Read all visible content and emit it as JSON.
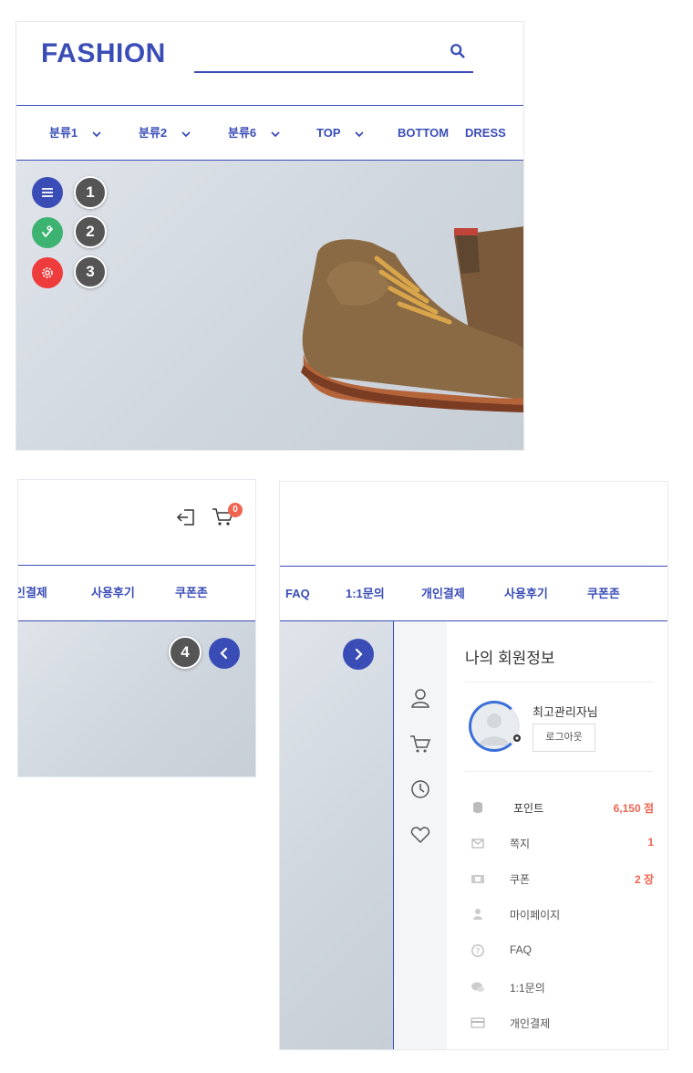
{
  "header": {
    "logo": "FASHION",
    "search_placeholder": ""
  },
  "nav_panel1": [
    {
      "label": "분류1",
      "has_dropdown": true
    },
    {
      "label": "분류2",
      "has_dropdown": true
    },
    {
      "label": "분류6",
      "has_dropdown": true
    },
    {
      "label": "TOP",
      "has_dropdown": true
    },
    {
      "label": "BOTTOM",
      "has_dropdown": false
    },
    {
      "label": "DRESS",
      "has_dropdown": false
    }
  ],
  "quick_buttons": [
    {
      "icon": "menu-icon",
      "badge": "1",
      "color": "#3a4db7"
    },
    {
      "icon": "thumb-icon",
      "badge": "2",
      "color": "#3cb371"
    },
    {
      "icon": "gear-icon",
      "badge": "3",
      "color": "#ee3b3b"
    }
  ],
  "panel2": {
    "cart_count": "0",
    "nav": [
      "인결제",
      "사용후기",
      "쿠폰존"
    ],
    "badge": "4"
  },
  "panel3": {
    "nav": [
      "FAQ",
      "1:1문의",
      "개인결제",
      "사용후기",
      "쿠폰존"
    ],
    "member_title": "나의 회원정보",
    "user_name": "최고관리자님",
    "logout_label": "로그아웃",
    "menu": [
      {
        "icon": "database-icon",
        "label": "포인트",
        "value": "6,150 점"
      },
      {
        "icon": "mail-icon",
        "label": "쪽지",
        "value": "1"
      },
      {
        "icon": "ticket-icon",
        "label": "쿠폰",
        "value": "2 장"
      },
      {
        "icon": "person-icon",
        "label": "마이페이지",
        "value": ""
      },
      {
        "icon": "question-icon",
        "label": "FAQ",
        "value": ""
      },
      {
        "icon": "chat-icon",
        "label": "1:1문의",
        "value": ""
      },
      {
        "icon": "card-icon",
        "label": "개인결제",
        "value": ""
      }
    ]
  },
  "colors": {
    "brand": "#3a4db7",
    "accent_value": "#f06451"
  }
}
